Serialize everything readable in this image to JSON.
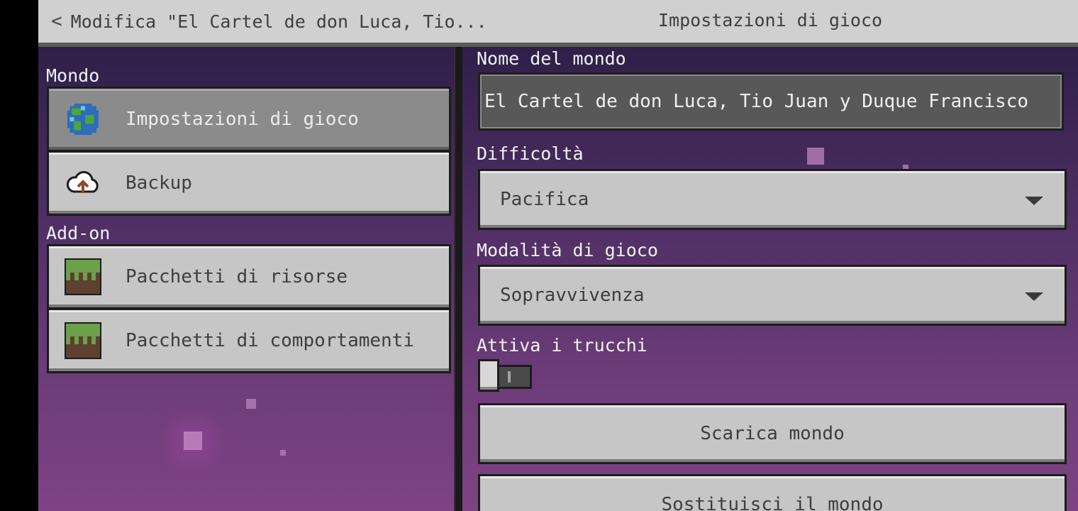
{
  "header": {
    "back_label": "Modifica \"El Cartel de don Luca, Tio...",
    "title": "Impostazioni di gioco"
  },
  "sidebar": {
    "world_section": "Mondo",
    "world_items": [
      {
        "label": "Impostazioni di gioco",
        "icon": "globe-icon",
        "active": true
      },
      {
        "label": "Backup",
        "icon": "cloud-upload-icon",
        "active": false
      }
    ],
    "addons_section": "Add-on",
    "addon_items": [
      {
        "label": "Pacchetti di risorse",
        "icon": "grass-block-icon"
      },
      {
        "label": "Pacchetti di comportamenti",
        "icon": "grass-block-icon"
      }
    ]
  },
  "settings": {
    "world_name_label": "Nome del mondo",
    "world_name_value": "El Cartel de don Luca, Tio Juan y Duque Francisco",
    "difficulty_label": "Difficoltà",
    "difficulty_value": "Pacifica",
    "gamemode_label": "Modalità di gioco",
    "gamemode_value": "Sopravvivenza",
    "cheats_label": "Attiva i trucchi",
    "cheats_enabled": false,
    "download_button": "Scarica mondo",
    "replace_button": "Sostituisci il mondo"
  }
}
